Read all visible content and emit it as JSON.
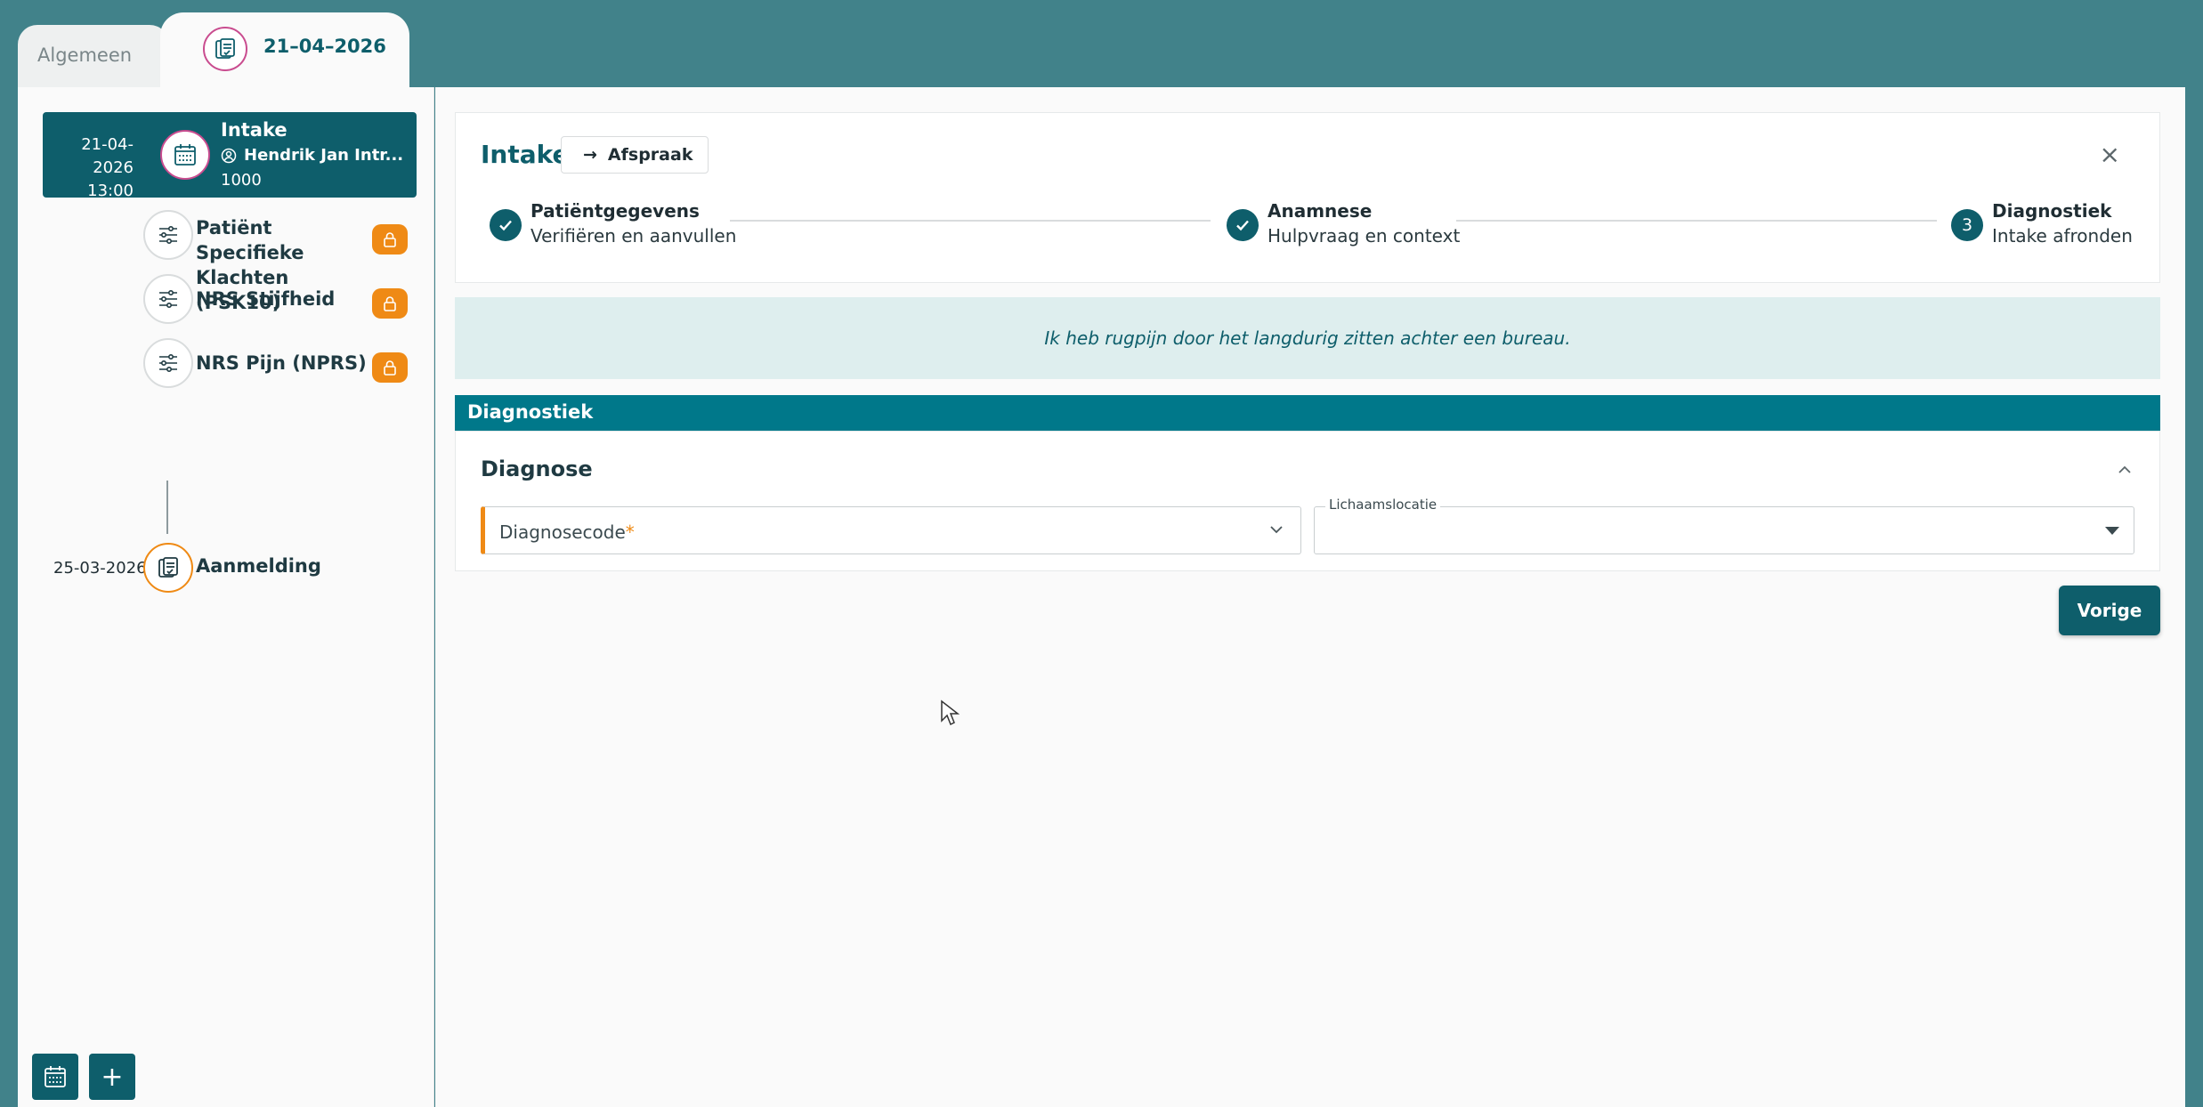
{
  "tabs": {
    "general_label": "Algemeen",
    "active_date": "21–04–2026"
  },
  "sidebar": {
    "active": {
      "date": "21-04-2026",
      "time": "13:00",
      "title": "Intake",
      "person": "Hendrik Jan Intr...",
      "number": "1000"
    },
    "subitems": [
      {
        "title": "Patiënt Specifieke Klachten (PSK10)",
        "locked": true
      },
      {
        "title": "NRS Stijfheid",
        "locked": true
      },
      {
        "title": "NRS Pijn (NPRS)",
        "locked": true
      }
    ],
    "aanmelding": {
      "date": "25-03-2026",
      "title": "Aanmelding"
    }
  },
  "header": {
    "title": "Intake",
    "afspraak_label": "Afspraak"
  },
  "steps": [
    {
      "title": "Patiëntgegevens",
      "subtitle": "Verifiëren en aanvullen",
      "state": "done"
    },
    {
      "title": "Anamnese",
      "subtitle": "Hulpvraag en context",
      "state": "done"
    },
    {
      "number": "3",
      "title": "Diagnostiek",
      "subtitle": "Intake afronden",
      "state": "current"
    }
  ],
  "quote": "Ik heb rugpijn door het langdurig zitten achter een bureau.",
  "section": {
    "header": "Diagnostiek",
    "title": "Diagnose",
    "diagnosecode_label": "Diagnosecode",
    "required_mark": "*",
    "lichaamslocatie_label": "Lichaamslocatie"
  },
  "buttons": {
    "vorige": "Vorige"
  },
  "colors": {
    "primary": "#0e5e6b",
    "accent": "#ef8a15",
    "section": "#00788a",
    "background": "#41828a"
  }
}
